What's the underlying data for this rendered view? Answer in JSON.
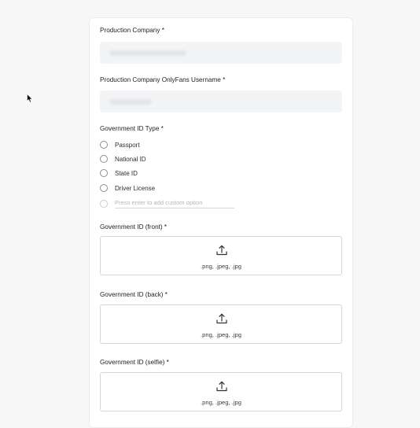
{
  "form": {
    "production_company": {
      "label": "Production Company *"
    },
    "onlyfans_username": {
      "label": "Production Company OnlyFans Username *"
    },
    "gov_id_type": {
      "label": "Government ID Type *",
      "options": [
        "Passport",
        "National ID",
        "State ID",
        "Driver License"
      ],
      "custom_placeholder": "Press enter to add custom option"
    },
    "gov_id_front": {
      "label": "Government ID (front) *",
      "formats": ".png, .jpeg, .jpg",
      "icon": "upload-icon"
    },
    "gov_id_back": {
      "label": "Government ID (back) *",
      "formats": ".png, .jpeg, .jpg",
      "icon": "upload-icon"
    },
    "gov_id_selfie": {
      "label": "Government ID (selfie) *",
      "formats": ".png, .jpeg, .jpg",
      "icon": "upload-icon"
    }
  }
}
